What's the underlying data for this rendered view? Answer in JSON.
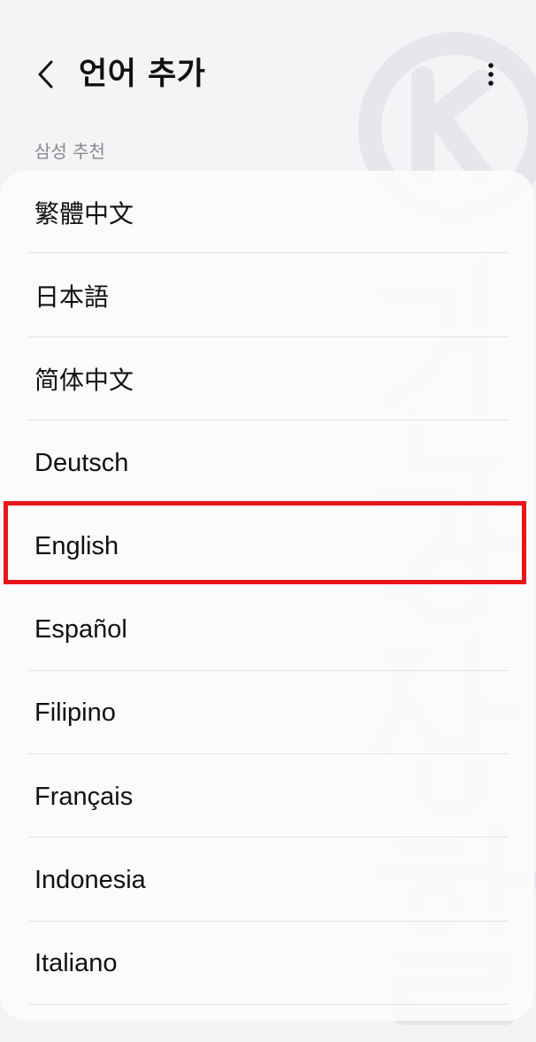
{
  "header": {
    "title": "언어 추가",
    "back_icon": "chevron-left-icon",
    "more_icon": "more-vertical-icon"
  },
  "section": {
    "label": "삼성 추천"
  },
  "languages": [
    {
      "label": "繁體中文"
    },
    {
      "label": "日本語"
    },
    {
      "label": "简体中文"
    },
    {
      "label": "Deutsch"
    },
    {
      "label": "English"
    },
    {
      "label": "Español"
    },
    {
      "label": "Filipino"
    },
    {
      "label": "Français"
    },
    {
      "label": "Indonesia"
    },
    {
      "label": "Italiano"
    }
  ],
  "highlight": {
    "item": "English",
    "color": "#e8161b"
  },
  "colors": {
    "background": "#f4f4f6",
    "card": "#fbfbfc",
    "section_label": "#8a8a8f",
    "watermark": "#e9e9ee"
  }
}
